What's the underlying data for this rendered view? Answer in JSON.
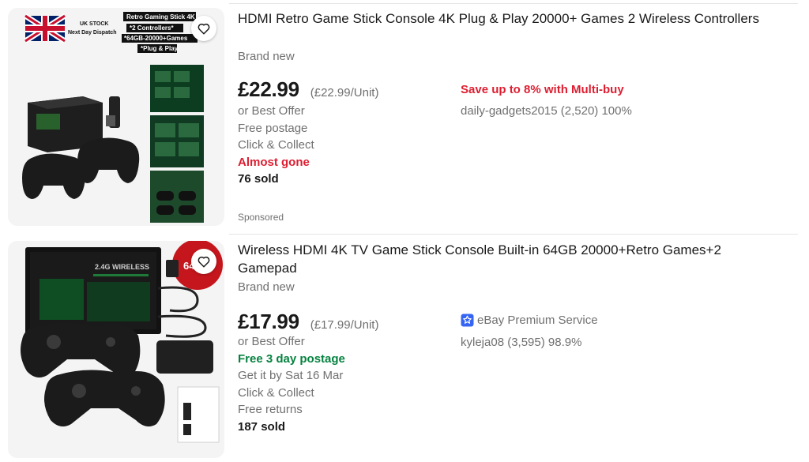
{
  "listings": [
    {
      "title": "HDMI Retro Game Stick Console 4K Plug & Play 20000+ Games 2 Wireless Controllers",
      "condition": "Brand new",
      "price": "£22.99",
      "unit_price": "(£22.99/Unit)",
      "best_offer": "or Best Offer",
      "postage": "Free postage",
      "collect": "Click & Collect",
      "urgency": "Almost gone",
      "sold": "76 sold",
      "promo": "Save up to 8% with Multi-buy",
      "seller": "daily-gadgets2015 (2,520) 100%",
      "sponsored": "Sponsored",
      "image_text": {
        "uk_stock": "UK STOCK",
        "dispatch": "Next Day Dispatch",
        "line1": "Retro Gaming Stick 4K",
        "line2": "*2 Controllers*",
        "line3": "*64GB-20000+Games",
        "line4": "*Plug & Play"
      }
    },
    {
      "title": "Wireless HDMI 4K TV Game Stick Console Built-in 64GB 20000+Retro Games+2 Gamepad",
      "condition": "Brand new",
      "price": "£17.99",
      "unit_price": "(£17.99/Unit)",
      "best_offer": "or Best Offer",
      "postage": "Free 3 day postage",
      "delivery": "Get it by Sat 16 Mar",
      "collect": "Click & Collect",
      "returns": "Free returns",
      "sold": "187 sold",
      "premium": "eBay Premium Service",
      "seller": "kyleja08 (3,595) 98.9%",
      "image_text": {
        "box_label": "2.4G WIRELESS",
        "badge": "64"
      }
    }
  ],
  "colors": {
    "red": "#dd1e31",
    "green": "#05823f",
    "premium_blue": "#3665f3",
    "text": "#191919",
    "secondary": "#707070"
  },
  "icons": {
    "wishlist": "heart-outline-icon",
    "premium": "ebay-premium-badge-icon"
  }
}
